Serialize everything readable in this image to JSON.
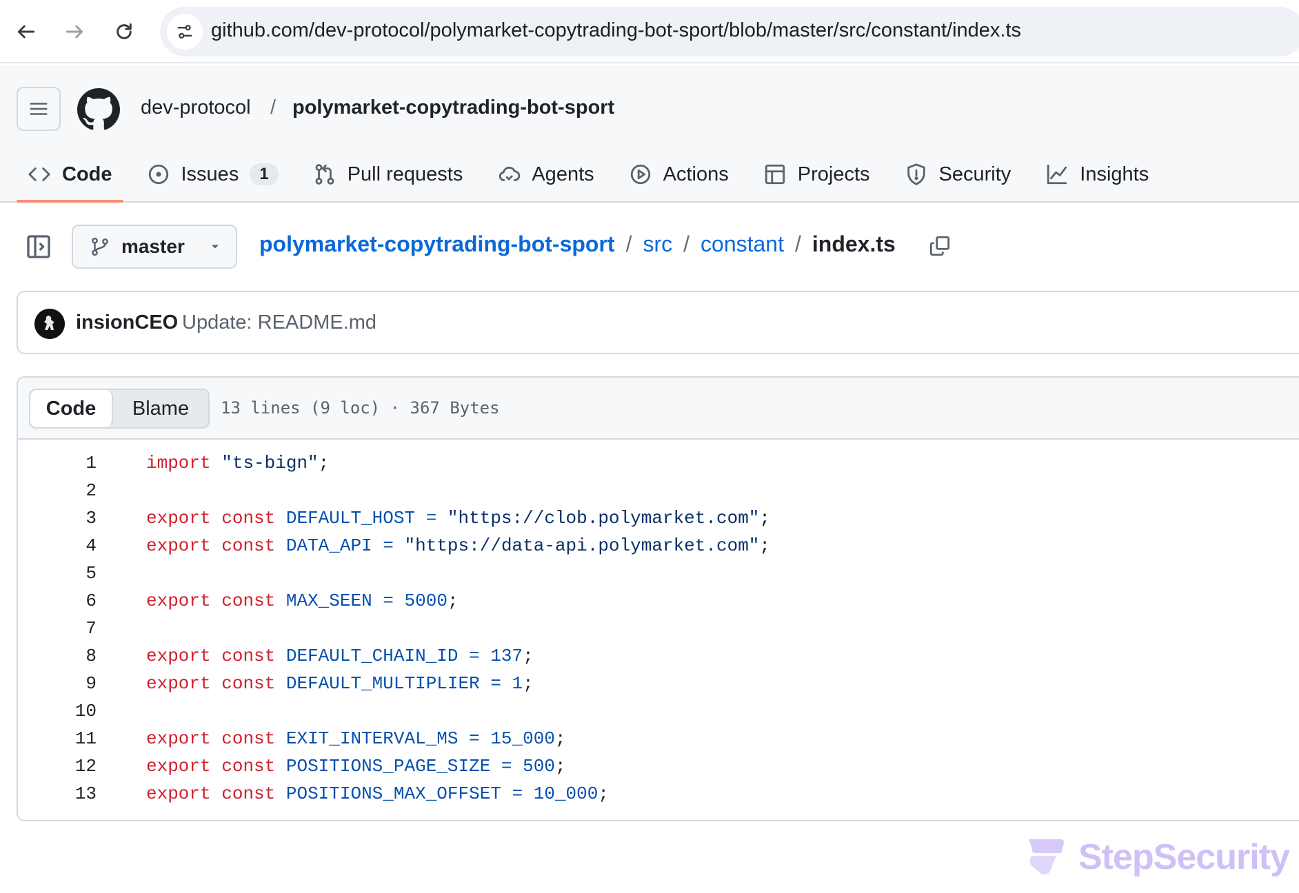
{
  "browser": {
    "url": "github.com/dev-protocol/polymarket-copytrading-bot-sport/blob/master/src/constant/index.ts"
  },
  "header": {
    "owner": "dev-protocol",
    "separator": "/",
    "repo": "polymarket-copytrading-bot-sport"
  },
  "tabs": [
    {
      "label": "Code",
      "icon": "code-icon",
      "active": true
    },
    {
      "label": "Issues",
      "icon": "issue-icon",
      "counter": "1"
    },
    {
      "label": "Pull requests",
      "icon": "pull-request-icon"
    },
    {
      "label": "Agents",
      "icon": "agents-icon"
    },
    {
      "label": "Actions",
      "icon": "play-icon"
    },
    {
      "label": "Projects",
      "icon": "table-icon"
    },
    {
      "label": "Security",
      "icon": "shield-icon"
    },
    {
      "label": "Insights",
      "icon": "graph-icon"
    }
  ],
  "file_nav": {
    "branch": "master",
    "breadcrumb": {
      "root": "polymarket-copytrading-bot-sport",
      "dir1": "src",
      "dir2": "constant",
      "file": "index.ts",
      "sep": "/"
    }
  },
  "commit": {
    "author": "insionCEO",
    "message": "Update: README.md"
  },
  "code_view": {
    "code_label": "Code",
    "blame_label": "Blame",
    "info": "13 lines (9 loc) · 367 Bytes",
    "lines": [
      {
        "n": "1",
        "tokens": [
          {
            "t": "import",
            "c": "kw"
          },
          {
            "t": " ",
            "c": "pl"
          },
          {
            "t": "\"ts-bign\"",
            "c": "str"
          },
          {
            "t": ";",
            "c": "pl"
          }
        ]
      },
      {
        "n": "2",
        "tokens": []
      },
      {
        "n": "3",
        "tokens": [
          {
            "t": "export",
            "c": "kw"
          },
          {
            "t": " ",
            "c": "pl"
          },
          {
            "t": "const",
            "c": "kw"
          },
          {
            "t": " ",
            "c": "pl"
          },
          {
            "t": "DEFAULT_HOST",
            "c": "id"
          },
          {
            "t": " ",
            "c": "pl"
          },
          {
            "t": "=",
            "c": "id"
          },
          {
            "t": " ",
            "c": "pl"
          },
          {
            "t": "\"https://clob.polymarket.com\"",
            "c": "str"
          },
          {
            "t": ";",
            "c": "pl"
          }
        ]
      },
      {
        "n": "4",
        "tokens": [
          {
            "t": "export",
            "c": "kw"
          },
          {
            "t": " ",
            "c": "pl"
          },
          {
            "t": "const",
            "c": "kw"
          },
          {
            "t": " ",
            "c": "pl"
          },
          {
            "t": "DATA_API",
            "c": "id"
          },
          {
            "t": " ",
            "c": "pl"
          },
          {
            "t": "=",
            "c": "id"
          },
          {
            "t": " ",
            "c": "pl"
          },
          {
            "t": "\"https://data-api.polymarket.com\"",
            "c": "str"
          },
          {
            "t": ";",
            "c": "pl"
          }
        ]
      },
      {
        "n": "5",
        "tokens": []
      },
      {
        "n": "6",
        "tokens": [
          {
            "t": "export",
            "c": "kw"
          },
          {
            "t": " ",
            "c": "pl"
          },
          {
            "t": "const",
            "c": "kw"
          },
          {
            "t": " ",
            "c": "pl"
          },
          {
            "t": "MAX_SEEN",
            "c": "id"
          },
          {
            "t": " ",
            "c": "pl"
          },
          {
            "t": "=",
            "c": "id"
          },
          {
            "t": " ",
            "c": "pl"
          },
          {
            "t": "5000",
            "c": "num"
          },
          {
            "t": ";",
            "c": "pl"
          }
        ]
      },
      {
        "n": "7",
        "tokens": []
      },
      {
        "n": "8",
        "tokens": [
          {
            "t": "export",
            "c": "kw"
          },
          {
            "t": " ",
            "c": "pl"
          },
          {
            "t": "const",
            "c": "kw"
          },
          {
            "t": " ",
            "c": "pl"
          },
          {
            "t": "DEFAULT_CHAIN_ID",
            "c": "id"
          },
          {
            "t": " ",
            "c": "pl"
          },
          {
            "t": "=",
            "c": "id"
          },
          {
            "t": " ",
            "c": "pl"
          },
          {
            "t": "137",
            "c": "num"
          },
          {
            "t": ";",
            "c": "pl"
          }
        ]
      },
      {
        "n": "9",
        "tokens": [
          {
            "t": "export",
            "c": "kw"
          },
          {
            "t": " ",
            "c": "pl"
          },
          {
            "t": "const",
            "c": "kw"
          },
          {
            "t": " ",
            "c": "pl"
          },
          {
            "t": "DEFAULT_MULTIPLIER",
            "c": "id"
          },
          {
            "t": " ",
            "c": "pl"
          },
          {
            "t": "=",
            "c": "id"
          },
          {
            "t": " ",
            "c": "pl"
          },
          {
            "t": "1",
            "c": "num"
          },
          {
            "t": ";",
            "c": "pl"
          }
        ]
      },
      {
        "n": "10",
        "tokens": []
      },
      {
        "n": "11",
        "tokens": [
          {
            "t": "export",
            "c": "kw"
          },
          {
            "t": " ",
            "c": "pl"
          },
          {
            "t": "const",
            "c": "kw"
          },
          {
            "t": " ",
            "c": "pl"
          },
          {
            "t": "EXIT_INTERVAL_MS",
            "c": "id"
          },
          {
            "t": " ",
            "c": "pl"
          },
          {
            "t": "=",
            "c": "id"
          },
          {
            "t": " ",
            "c": "pl"
          },
          {
            "t": "15_000",
            "c": "num"
          },
          {
            "t": ";",
            "c": "pl"
          }
        ]
      },
      {
        "n": "12",
        "tokens": [
          {
            "t": "export",
            "c": "kw"
          },
          {
            "t": " ",
            "c": "pl"
          },
          {
            "t": "const",
            "c": "kw"
          },
          {
            "t": " ",
            "c": "pl"
          },
          {
            "t": "POSITIONS_PAGE_SIZE",
            "c": "id"
          },
          {
            "t": " ",
            "c": "pl"
          },
          {
            "t": "=",
            "c": "id"
          },
          {
            "t": " ",
            "c": "pl"
          },
          {
            "t": "500",
            "c": "num"
          },
          {
            "t": ";",
            "c": "pl"
          }
        ]
      },
      {
        "n": "13",
        "tokens": [
          {
            "t": "export",
            "c": "kw"
          },
          {
            "t": " ",
            "c": "pl"
          },
          {
            "t": "const",
            "c": "kw"
          },
          {
            "t": " ",
            "c": "pl"
          },
          {
            "t": "POSITIONS_MAX_OFFSET",
            "c": "id"
          },
          {
            "t": " ",
            "c": "pl"
          },
          {
            "t": "=",
            "c": "id"
          },
          {
            "t": " ",
            "c": "pl"
          },
          {
            "t": "10_000",
            "c": "num"
          },
          {
            "t": ";",
            "c": "pl"
          }
        ]
      }
    ]
  },
  "watermark": {
    "text": "StepSecurity"
  },
  "colors": {
    "keyword": "#cf222e",
    "string": "#0a3069",
    "identifier": "#0550ae",
    "link": "#0969da",
    "active_tab_underline": "#fd8c73",
    "watermark": "#a88df0"
  }
}
